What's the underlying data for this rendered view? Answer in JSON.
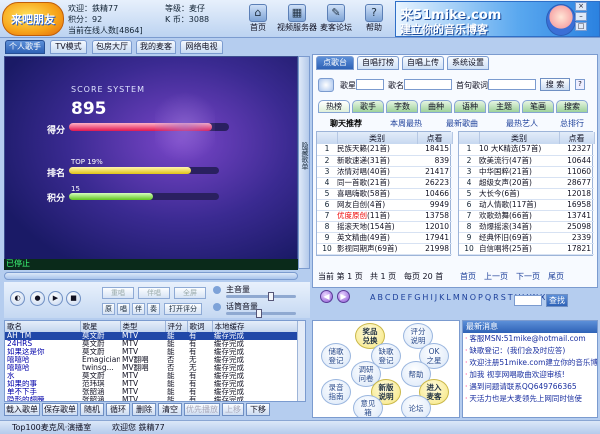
{
  "app": {
    "logo": "来吧朋友"
  },
  "user": {
    "welcome": "欢迎：鉄精77",
    "level": "等级：麦仔",
    "points": "积分：92",
    "kcoin": "K 币：3088",
    "online": "当前在线人数[4864]"
  },
  "nav": [
    {
      "label": "首页",
      "icon": "⌂"
    },
    {
      "label": "视频服务器",
      "icon": "▦"
    },
    {
      "label": "麦客论坛",
      "icon": "✎"
    },
    {
      "label": "帮助",
      "icon": "?"
    }
  ],
  "banner": {
    "line1": "来51mike.com",
    "line2": "建立你的音乐博客"
  },
  "modes": [
    "个人歌手",
    "TV模式",
    "包房大厅",
    "我的麦客",
    "网络电视"
  ],
  "score": {
    "system_title": "SCORE SYSTEM",
    "score": "895",
    "score_label": "得分",
    "rank_tag": "TOP 19%",
    "rank_label": "排名",
    "points_num": "15",
    "points_label": "积分",
    "score_pct": 0.895,
    "rank_pct": 0.81,
    "points_pct": 0.56
  },
  "side_button": "隐藏歌单",
  "status": "已停止",
  "controls": {
    "chorus": "重唱",
    "accompany": "伴唱",
    "original": "原唱",
    "fullscreen": "全屏",
    "tag1": "原",
    "tag2": "唱",
    "tag3": "伴",
    "tag4": "奏",
    "open_upload": "打开评分",
    "master_volume": "主音量",
    "mic_volume": "话筒音量"
  },
  "playlist": {
    "headers": [
      "歌名",
      "歌星",
      "类型",
      "评分",
      "歌词",
      "本地缓存"
    ],
    "rows": [
      [
        "AH TM",
        "莫文蔚",
        "MTV",
        "能",
        "有",
        "缓存完成"
      ],
      [
        "24HRS",
        "莫文蔚",
        "MTV",
        "能",
        "有",
        "缓存完成"
      ],
      [
        "如果这是你",
        "莫文蔚",
        "MTV",
        "能",
        "有",
        "缓存完成"
      ],
      [
        "嘻嘻哈",
        "Emagician",
        "MV翻唱",
        "否",
        "无",
        "缓存完成"
      ],
      [
        "嘻嘻哈",
        "twinsg...",
        "MV翻唱",
        "否",
        "无",
        "缓存完成"
      ],
      [
        "水",
        "莫文蔚",
        "MTV",
        "能",
        "有",
        "缓存完成"
      ],
      [
        "如果的事",
        "范玮琪",
        "MTV",
        "能",
        "有",
        "缓存完成"
      ],
      [
        "单不下手",
        "张韶涵",
        "MTV",
        "能",
        "有",
        "缓存完成"
      ],
      [
        "隐形的翅膀",
        "张韶涵",
        "MTV",
        "能",
        "有",
        "缓存完成"
      ]
    ]
  },
  "list_buttons": [
    "载入歌单",
    "保存歌单",
    "随机",
    "循环",
    "删除",
    "清空",
    "优先播放",
    "上移",
    "下移"
  ],
  "bottom": {
    "now": "Top100麦克风·演播室",
    "welcome": "欢迎您  鉄精77"
  },
  "song_tabs": [
    "点歌台",
    "自唱打榜",
    "自唱上传",
    "系统设置"
  ],
  "search": {
    "singer": "歌星",
    "song": "歌名",
    "lyric": "首句歌词",
    "go": "搜 索"
  },
  "cat_tabs": [
    "热榜",
    "歌手",
    "字数",
    "曲种",
    "语种",
    "主题",
    "笔画",
    "搜索"
  ],
  "cat_links": [
    "聊天推荐",
    "本周最热",
    "最新歌曲",
    "最热艺人",
    "总排行"
  ],
  "rank_headers": [
    "类别",
    "点看"
  ],
  "rank_left": [
    [
      "民族天籁",
      "(21首)",
      "18415"
    ],
    [
      "新歌速递",
      "(31首)",
      "839"
    ],
    [
      "浓情对唱",
      "(40首)",
      "21417"
    ],
    [
      "同一首歌",
      "(21首)",
      "26223"
    ],
    [
      "喜唱嗨歌",
      "(58首)",
      "10466"
    ],
    [
      "网友自创",
      "(4首)",
      "9949"
    ],
    [
      "优度原创",
      "(11首)",
      "13758"
    ],
    [
      "摇滚天地",
      "(154首)",
      "12010"
    ],
    [
      "英文精曲",
      "(49首)",
      "17941"
    ],
    [
      "影视同期声",
      "(69首)",
      "21998"
    ]
  ],
  "rank_right": [
    [
      "10 大K精选",
      "(57首)",
      "12327"
    ],
    [
      "欧美流行",
      "(47首)",
      "10644"
    ],
    [
      "中华国粹",
      "(21首)",
      "11060"
    ],
    [
      "超级女声",
      "(20首)",
      "28677"
    ],
    [
      "大长今",
      "(6首)",
      "12018"
    ],
    [
      "动人情歌",
      "(117首)",
      "16958"
    ],
    [
      "欢歌劲舞",
      "(66首)",
      "13741"
    ],
    [
      "劲爆摇滚",
      "(34首)",
      "25098"
    ],
    [
      "经典怀旧",
      "(69首)",
      "2339"
    ],
    [
      "自信唱将",
      "(25首)",
      "17821"
    ]
  ],
  "pager": {
    "page": "当前 第 1 页",
    "total": "共 1 页",
    "per": "每页 20 首",
    "first": "首页",
    "prev": "上一页",
    "next": "下一页",
    "last": "尾页"
  },
  "letters": "ABCDEFGHIJKLMNOPQRSTUVWXYZ",
  "goto": "查找",
  "hexes": [
    {
      "t": "奖品\n兑换",
      "y": true
    },
    {
      "t": "评分\n说明",
      "y": false
    },
    {
      "t": "储歌\n登记",
      "y": false
    },
    {
      "t": "缺歌\n登记",
      "y": false
    },
    {
      "t": "OK\n之星",
      "y": false
    },
    {
      "t": "调研\n问卷",
      "y": false
    },
    {
      "t": "帮助",
      "y": false
    },
    {
      "t": "录音\n指南",
      "y": false
    },
    {
      "t": "新版\n说明",
      "y": true
    },
    {
      "t": "进入\n麦客",
      "y": true
    },
    {
      "t": "意见\n箱",
      "y": false
    },
    {
      "t": "论坛",
      "y": false
    }
  ],
  "news": {
    "title": "最新消息",
    "items": [
      "客服MSN:51mike@hotmail.com",
      "缺歌登记：(我们会及时应答)",
      "欢迎注册51mike.com建立你的音乐博客",
      "加我 视享网唱歌曲欢迎审核!",
      "遇到问题请联系QQ649766365",
      "天活力也是大麦领先上网同时信使"
    ]
  }
}
